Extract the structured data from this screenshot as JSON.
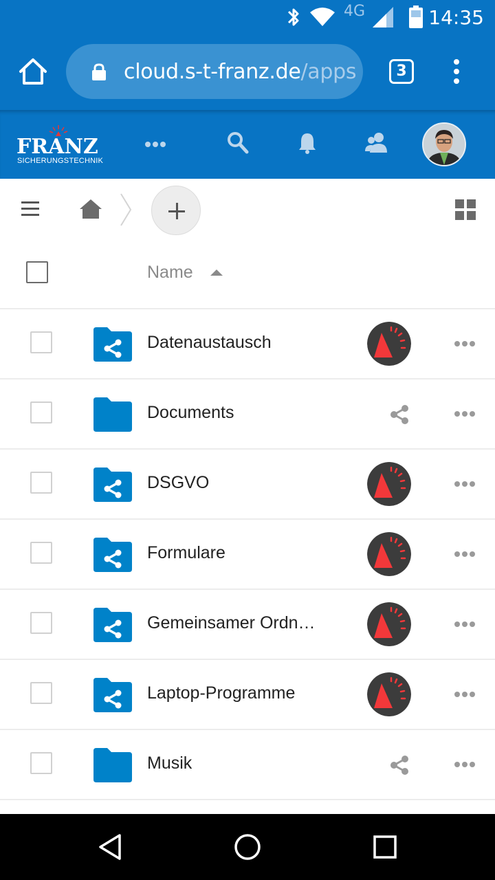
{
  "status_bar": {
    "time": "14:35",
    "network": "4G",
    "icons": [
      "bluetooth-icon",
      "wifi-icon",
      "cell-signal-icon",
      "battery-icon"
    ]
  },
  "browser": {
    "url_domain": "cloud.s-t-franz.de",
    "url_path": "/apps",
    "tab_count": "3",
    "icons": [
      "home-icon",
      "lock-icon",
      "overflow-menu-icon"
    ]
  },
  "app_header": {
    "logo_brand": "FRANZ",
    "logo_sub": "SICHERUNGSTECHNIK",
    "icons": [
      "more-apps-icon",
      "search-icon",
      "bell-icon",
      "contacts-icon"
    ]
  },
  "toolbar": {
    "icons": [
      "hamburger-icon",
      "home-icon",
      "add-icon",
      "grid-view-icon"
    ]
  },
  "table": {
    "column_name": "Name",
    "rows": [
      {
        "name": "Datenaustausch",
        "shared": true
      },
      {
        "name": "Documents",
        "shared": false
      },
      {
        "name": "DSGVO",
        "shared": true
      },
      {
        "name": "Formulare",
        "shared": true
      },
      {
        "name": "Gemeinsamer Ordn…",
        "shared": true
      },
      {
        "name": "Laptop-Programme",
        "shared": true
      },
      {
        "name": "Musik",
        "shared": false
      }
    ]
  },
  "colors": {
    "brand_blue": "#0874c4",
    "folder_blue": "#0082c9",
    "avatar_red": "#f2383a"
  },
  "nav_bar": {
    "icons": [
      "back-icon",
      "home-circle-icon",
      "recents-icon"
    ]
  }
}
